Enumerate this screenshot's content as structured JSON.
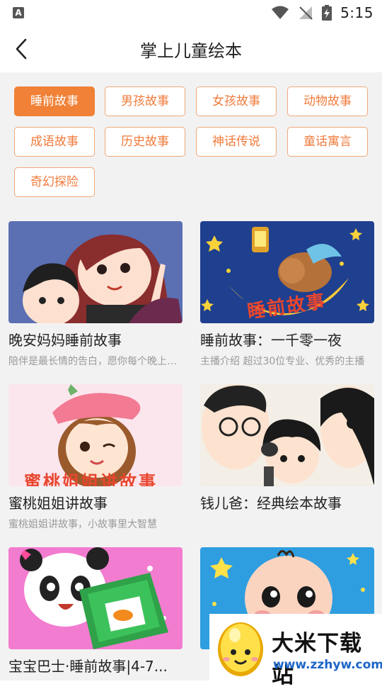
{
  "status_bar": {
    "time": "5:15",
    "app_icon_letter": "A"
  },
  "header": {
    "title": "掌上儿童绘本"
  },
  "categories": [
    {
      "label": "睡前故事",
      "active": true
    },
    {
      "label": "男孩故事",
      "active": false
    },
    {
      "label": "女孩故事",
      "active": false
    },
    {
      "label": "动物故事",
      "active": false
    },
    {
      "label": "成语故事",
      "active": false
    },
    {
      "label": "历史故事",
      "active": false
    },
    {
      "label": "神话传说",
      "active": false
    },
    {
      "label": "童话寓言",
      "active": false
    },
    {
      "label": "奇幻探险",
      "active": false
    }
  ],
  "books": [
    {
      "title": "晚安妈妈睡前故事",
      "desc": "陪伴是最长情的告白，愿你每个晚上都有好梦"
    },
    {
      "title": "睡前故事：一千零一夜",
      "desc": "主播介绍 超过30位专业、优秀的主播"
    },
    {
      "title": "蜜桃姐姐讲故事",
      "desc": "蜜桃姐姐讲故事，小故事里大智慧"
    },
    {
      "title": "钱儿爸：经典绘本故事",
      "desc": ""
    },
    {
      "title": "宝宝巴士·睡前故事|4-7...",
      "desc": ""
    },
    {
      "title": "",
      "desc": ""
    }
  ],
  "thumb_texts": {
    "book2": "睡前故事",
    "book3": "蜜桃姐姐讲故事"
  },
  "watermark": {
    "name": "大米下载站",
    "url": "www.zzhyw.com"
  },
  "colors": {
    "accent": "#f08136",
    "tag_border": "#f0a878",
    "background": "#f2f2f2"
  }
}
